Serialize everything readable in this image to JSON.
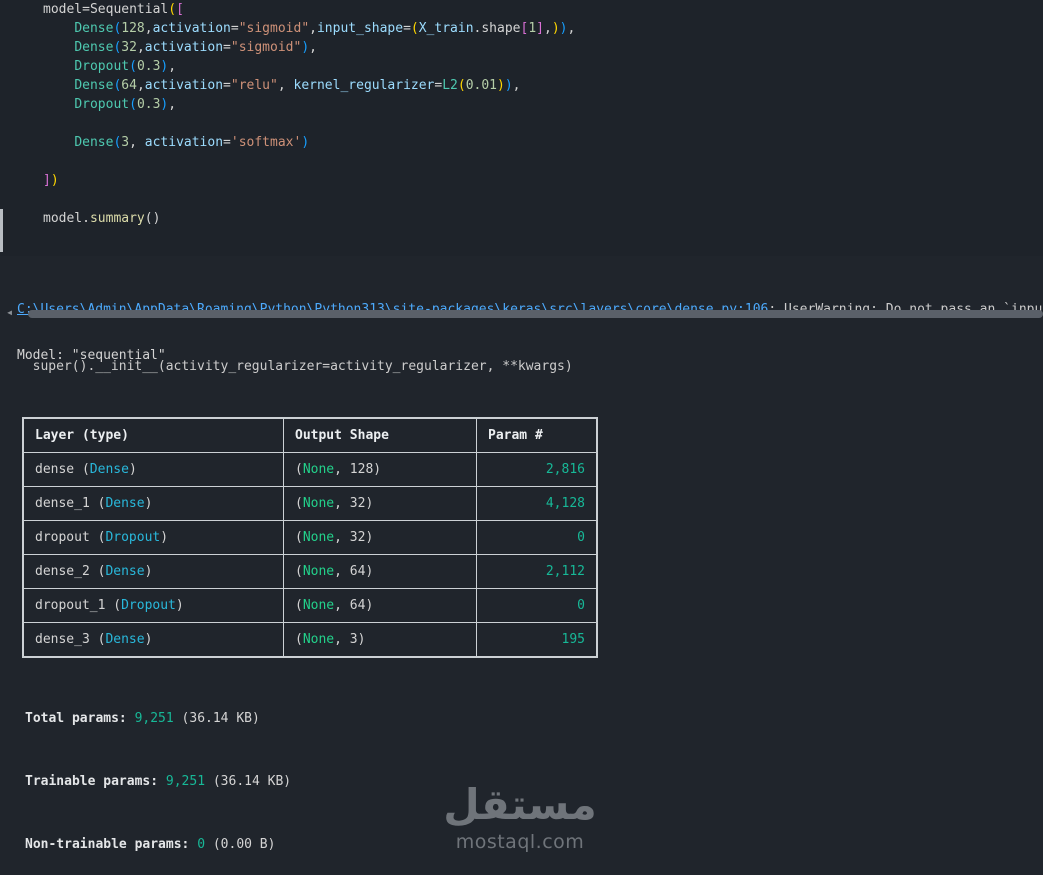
{
  "colors": {
    "background": "#20252c",
    "code_cell_background": "#1e232a",
    "plain_text": "#d4d4d4",
    "class_name": "#4ec9b0",
    "parameter": "#9cdcfe",
    "string": "#ce9178",
    "number": "#b5cea8",
    "link": "#4daafc",
    "table_border": "#ccd1d5",
    "layer_type": "#29b8db",
    "none_keyword": "#23d18b",
    "param_number": "#17b897"
  },
  "code": {
    "lines": [
      [
        {
          "t": "model=Sequential",
          "c": "plain"
        },
        {
          "t": "(",
          "c": "b1"
        },
        {
          "t": "[",
          "c": "b2"
        }
      ],
      [
        {
          "t": "    ",
          "c": "plain"
        },
        {
          "t": "Dense",
          "c": "class"
        },
        {
          "t": "(",
          "c": "b3"
        },
        {
          "t": "128",
          "c": "number"
        },
        {
          "t": ",",
          "c": "plain"
        },
        {
          "t": "activation",
          "c": "param"
        },
        {
          "t": "=",
          "c": "plain"
        },
        {
          "t": "\"sigmoid\"",
          "c": "string"
        },
        {
          "t": ",",
          "c": "plain"
        },
        {
          "t": "input_shape",
          "c": "param"
        },
        {
          "t": "=",
          "c": "plain"
        },
        {
          "t": "(",
          "c": "b1"
        },
        {
          "t": "X_train",
          "c": "param"
        },
        {
          "t": ".shape",
          "c": "plain"
        },
        {
          "t": "[",
          "c": "b2"
        },
        {
          "t": "1",
          "c": "number"
        },
        {
          "t": "]",
          "c": "b2"
        },
        {
          "t": ",",
          "c": "plain"
        },
        {
          "t": ")",
          "c": "b1"
        },
        {
          "t": ")",
          "c": "b3"
        },
        {
          "t": ",",
          "c": "plain"
        }
      ],
      [
        {
          "t": "    ",
          "c": "plain"
        },
        {
          "t": "Dense",
          "c": "class"
        },
        {
          "t": "(",
          "c": "b3"
        },
        {
          "t": "32",
          "c": "number"
        },
        {
          "t": ",",
          "c": "plain"
        },
        {
          "t": "activation",
          "c": "param"
        },
        {
          "t": "=",
          "c": "plain"
        },
        {
          "t": "\"sigmoid\"",
          "c": "string"
        },
        {
          "t": ")",
          "c": "b3"
        },
        {
          "t": ",",
          "c": "plain"
        }
      ],
      [
        {
          "t": "    ",
          "c": "plain"
        },
        {
          "t": "Dropout",
          "c": "class"
        },
        {
          "t": "(",
          "c": "b3"
        },
        {
          "t": "0.3",
          "c": "number"
        },
        {
          "t": ")",
          "c": "b3"
        },
        {
          "t": ",",
          "c": "plain"
        }
      ],
      [
        {
          "t": "    ",
          "c": "plain"
        },
        {
          "t": "Dense",
          "c": "class"
        },
        {
          "t": "(",
          "c": "b3"
        },
        {
          "t": "64",
          "c": "number"
        },
        {
          "t": ",",
          "c": "plain"
        },
        {
          "t": "activation",
          "c": "param"
        },
        {
          "t": "=",
          "c": "plain"
        },
        {
          "t": "\"relu\"",
          "c": "string"
        },
        {
          "t": ", ",
          "c": "plain"
        },
        {
          "t": "kernel_regularizer",
          "c": "param"
        },
        {
          "t": "=",
          "c": "plain"
        },
        {
          "t": "L2",
          "c": "class"
        },
        {
          "t": "(",
          "c": "b1"
        },
        {
          "t": "0.01",
          "c": "number"
        },
        {
          "t": ")",
          "c": "b1"
        },
        {
          "t": ")",
          "c": "b3"
        },
        {
          "t": ",",
          "c": "plain"
        }
      ],
      [
        {
          "t": "    ",
          "c": "plain"
        },
        {
          "t": "Dropout",
          "c": "class"
        },
        {
          "t": "(",
          "c": "b3"
        },
        {
          "t": "0.3",
          "c": "number"
        },
        {
          "t": ")",
          "c": "b3"
        },
        {
          "t": ",",
          "c": "plain"
        }
      ],
      [],
      [
        {
          "t": "    ",
          "c": "plain"
        },
        {
          "t": "Dense",
          "c": "class"
        },
        {
          "t": "(",
          "c": "b3"
        },
        {
          "t": "3",
          "c": "number"
        },
        {
          "t": ", ",
          "c": "plain"
        },
        {
          "t": "activation",
          "c": "param"
        },
        {
          "t": "=",
          "c": "plain"
        },
        {
          "t": "'softmax'",
          "c": "string"
        },
        {
          "t": ")",
          "c": "b3"
        }
      ],
      [],
      [
        {
          "t": "]",
          "c": "b2"
        },
        {
          "t": ")",
          "c": "b1"
        }
      ],
      [],
      [
        {
          "t": "model.",
          "c": "plain"
        },
        {
          "t": "summary",
          "c": "method"
        },
        {
          "t": "()",
          "c": "plain"
        }
      ]
    ]
  },
  "warning": {
    "link": "C:\\Users\\Admin\\AppData\\Roaming\\Python\\Python313\\site-packages\\keras\\src\\layers\\core\\dense.py:106",
    "rest": ": UserWarning: Do not pass an `input_",
    "line2": "  super().__init__(activity_regularizer=activity_regularizer, **kwargs)"
  },
  "scrollbar": {
    "left_arrow_glyph": "◂"
  },
  "model_line": "Model: \"sequential\"",
  "table": {
    "headers": [
      "Layer (type)",
      "Output Shape",
      "Param #"
    ],
    "rows": [
      {
        "layer_prefix": "dense (",
        "layer_type": "Dense",
        "layer_suffix": ")",
        "shape_open": "(",
        "shape_none": "None",
        "shape_rest": ", 128)",
        "param": "2,816"
      },
      {
        "layer_prefix": "dense_1 (",
        "layer_type": "Dense",
        "layer_suffix": ")",
        "shape_open": "(",
        "shape_none": "None",
        "shape_rest": ", 32)",
        "param": "4,128"
      },
      {
        "layer_prefix": "dropout (",
        "layer_type": "Dropout",
        "layer_suffix": ")",
        "shape_open": "(",
        "shape_none": "None",
        "shape_rest": ", 32)",
        "param": "0"
      },
      {
        "layer_prefix": "dense_2 (",
        "layer_type": "Dense",
        "layer_suffix": ")",
        "shape_open": "(",
        "shape_none": "None",
        "shape_rest": ", 64)",
        "param": "2,112"
      },
      {
        "layer_prefix": "dropout_1 (",
        "layer_type": "Dropout",
        "layer_suffix": ")",
        "shape_open": "(",
        "shape_none": "None",
        "shape_rest": ", 64)",
        "param": "0"
      },
      {
        "layer_prefix": "dense_3 (",
        "layer_type": "Dense",
        "layer_suffix": ")",
        "shape_open": "(",
        "shape_none": "None",
        "shape_rest": ", 3)",
        "param": "195"
      }
    ]
  },
  "summary": {
    "total_label": "Total params: ",
    "total_value": "9,251",
    "total_rest": " (36.14 KB)",
    "trainable_label": "Trainable params: ",
    "trainable_value": "9,251",
    "trainable_rest": " (36.14 KB)",
    "nontrainable_label": "Non-trainable params: ",
    "nontrainable_value": "0",
    "nontrainable_rest": " (0.00 B)"
  },
  "watermark": {
    "arabic": "مستقل",
    "domain": "mostaql.com"
  }
}
